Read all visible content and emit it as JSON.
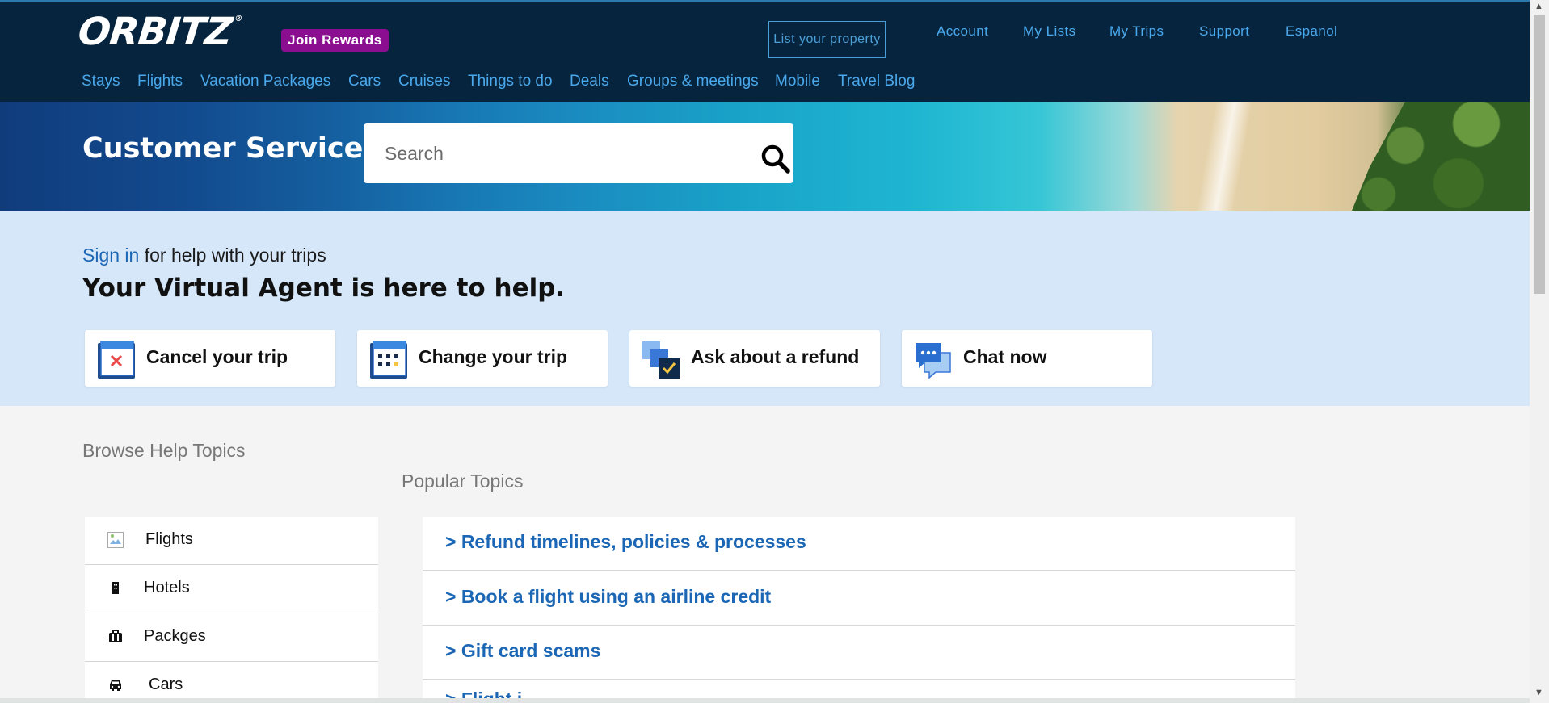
{
  "header": {
    "logo": "ORBITZ",
    "logo_reg": "®",
    "join_rewards": "Join Rewards",
    "list_property": "List your property",
    "top_links": [
      "Account",
      "My Lists",
      "My Trips",
      "Support",
      "Espanol"
    ],
    "nav": [
      "Stays",
      "Flights",
      "Vacation Packages",
      "Cars",
      "Cruises",
      "Things to do",
      "Deals",
      "Groups & meetings",
      "Mobile",
      "Travel Blog"
    ]
  },
  "hero": {
    "title": "Customer Service",
    "search_placeholder": "Search"
  },
  "agent": {
    "signin_link": "Sign in",
    "signin_rest": " for help with your trips",
    "title": "Your Virtual Agent is here to help.",
    "cards": [
      {
        "label": "Cancel your trip",
        "icon": "calendar-cancel-icon"
      },
      {
        "label": "Change your trip",
        "icon": "calendar-change-icon"
      },
      {
        "label": "Ask about a refund",
        "icon": "refund-icon"
      },
      {
        "label": "Chat now",
        "icon": "chat-icon"
      }
    ]
  },
  "browse": {
    "title": "Browse Help Topics",
    "categories": [
      {
        "label": "Flights",
        "icon": "broken-image-icon"
      },
      {
        "label": "Hotels",
        "icon": "hotel-icon"
      },
      {
        "label": "Packges",
        "icon": "luggage-icon"
      },
      {
        "label": "Cars",
        "icon": "car-icon"
      }
    ]
  },
  "popular": {
    "title": "Popular Topics",
    "topics": [
      "> Refund timelines, policies & processes",
      "> Book a flight using an airline credit",
      "> Gift card scams",
      "> Flight i..."
    ]
  },
  "colors": {
    "header_bg": "#06243d",
    "link": "#4aa8ec",
    "rewards": "#8a0e8f",
    "agent_bg": "#d6e7f9",
    "topic_link": "#1b67b5"
  }
}
